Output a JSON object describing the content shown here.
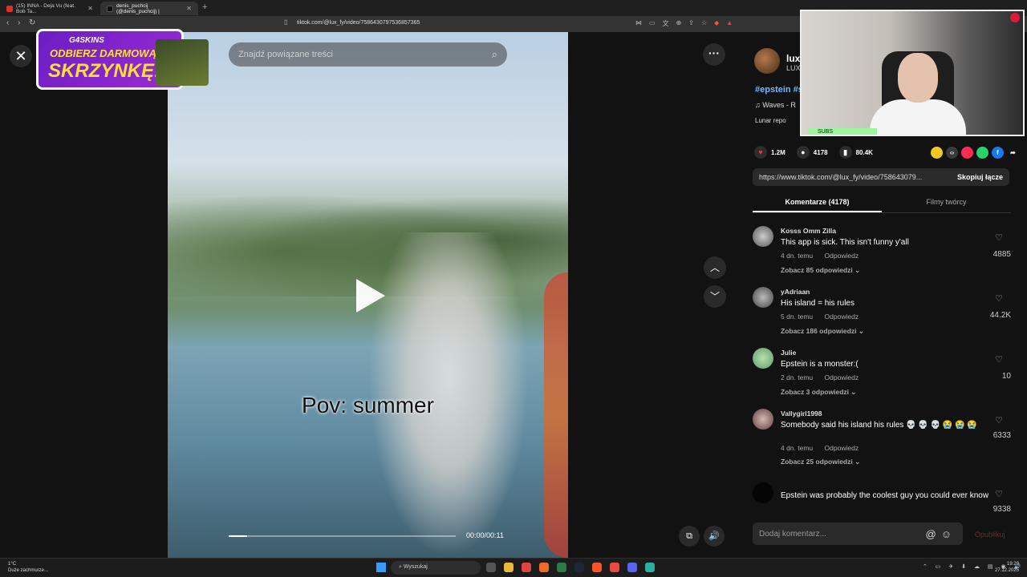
{
  "browser": {
    "tabs": [
      {
        "label": "(15) INNA - Deja Vu (feat. Bob Ta..."
      },
      {
        "label": "denis_puchcij (@denis_puchcij) |"
      }
    ],
    "url": "tiktok.com/@lux_fy/video/7586430797536857365"
  },
  "promo": {
    "brand": "G4SKINS",
    "line1": "ODBIERZ DARMOWĄ",
    "line2": "SKRZYNKĘ!"
  },
  "video": {
    "search_placeholder": "Znajdź powiązane treści",
    "caption": "Pov: summer",
    "time": "00:00/00:11",
    "progress": 0.08
  },
  "creator": {
    "name": "lux_",
    "sub": "LUX",
    "hashtags": "#epstein #s",
    "music": "♫  Waves - R",
    "lunar": "Lunar repo"
  },
  "stats": {
    "likes": "1.2M",
    "comments": "4178",
    "saves": "80.4K"
  },
  "link": {
    "url": "https://www.tiktok.com/@lux_fy/video/758643079...",
    "copy_label": "Skopiuj łącze"
  },
  "tabs": {
    "comments": "Komentarze (4178)",
    "creator_videos": "Filmy twórcy"
  },
  "comments": [
    {
      "user": "Kosss Omm Zilla",
      "text": "This app is sick. This isn't funny y'all",
      "age": "4 dn. temu",
      "reply": "Odpowiedz",
      "replies": "Zobacz 85 odpowiedzi",
      "likes": "4885"
    },
    {
      "user": "yAdriaan",
      "text": "His island = his rules",
      "age": "5 dn. temu",
      "reply": "Odpowiedz",
      "replies": "Zobacz 186 odpowiedzi",
      "likes": "44.2K"
    },
    {
      "user": "Julie",
      "text": "Epstein is a monster:(",
      "age": "2 dn. temu",
      "reply": "Odpowiedz",
      "replies": "Zobacz 3 odpowiedzi",
      "likes": "10"
    },
    {
      "user": "Vallygirl1998",
      "text": "Somebody said his island his rules 💀 💀 💀 😭 😭 😭",
      "age": "4 dn. temu",
      "reply": "Odpowiedz",
      "replies": "Zobacz 25 odpowiedzi",
      "likes": "6333"
    },
    {
      "user": "",
      "text": "Epstein was probably the coolest guy you could ever know",
      "age": "",
      "reply": "",
      "replies": "",
      "likes": "9338"
    }
  ],
  "add_comment": {
    "placeholder": "Dodaj komentarz...",
    "publish": "Opublikuj"
  },
  "webcam": {
    "subs_label": "SUBS"
  },
  "taskbar": {
    "temp": "1°C",
    "weather": "Duże zachmurze...",
    "search": "Wyszukaj",
    "time": "19:20",
    "date": "27.12.2025"
  }
}
